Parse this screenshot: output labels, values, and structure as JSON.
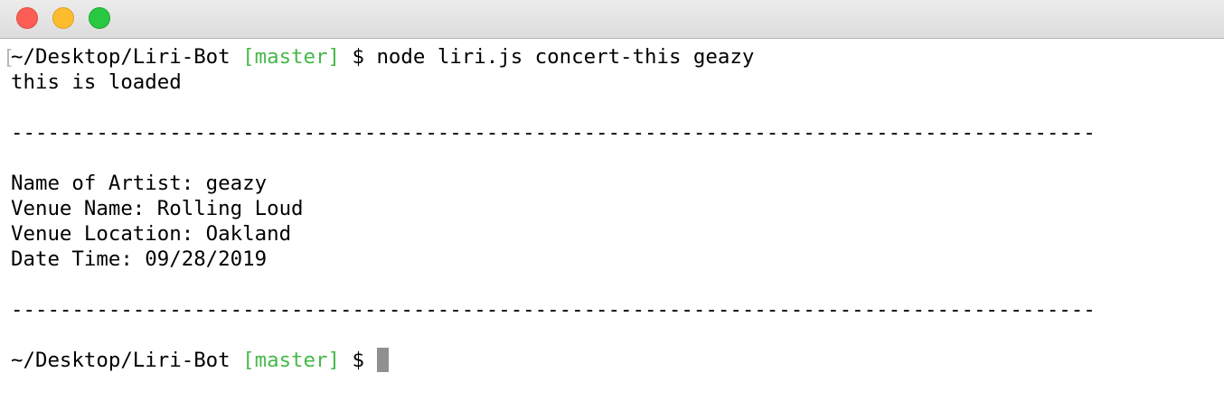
{
  "window": {
    "buttons": [
      "close",
      "minimize",
      "zoom"
    ]
  },
  "terminal": {
    "prompt_path": "~/Desktop/Liri-Bot",
    "prompt_branch": "[master]",
    "prompt_symbol": "$",
    "command": "node liri.js concert-this geazy",
    "output": {
      "loaded": "this is loaded",
      "separator": "-----------------------------------------------------------------------------------------",
      "artist": "Name of Artist: geazy",
      "venue": "Venue Name: Rolling Loud",
      "location": "Venue Location: Oakland",
      "datetime": "Date Time: 09/28/2019"
    }
  },
  "colors": {
    "branch": "#46b84a",
    "cursor": "#909090"
  }
}
